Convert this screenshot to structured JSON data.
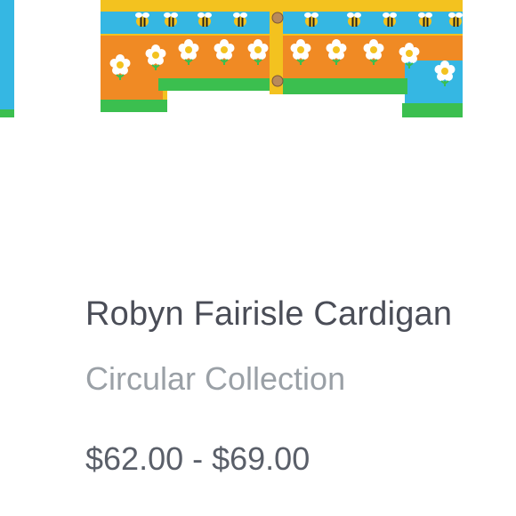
{
  "product": {
    "image_alt": "Robyn Fairisle Cardigan",
    "title": "Robyn Fairisle Cardigan",
    "brand": "Circular Collection",
    "price": "$62.00 - $69.00"
  },
  "colors": {
    "yellow": "#f3c21f",
    "blue": "#35b7e3",
    "orange": "#f08a24",
    "green": "#3bbf4f",
    "white": "#ffffff",
    "title_text": "#4a4d57",
    "brand_text": "#9aa0a6",
    "price_text": "#5a5f69"
  }
}
